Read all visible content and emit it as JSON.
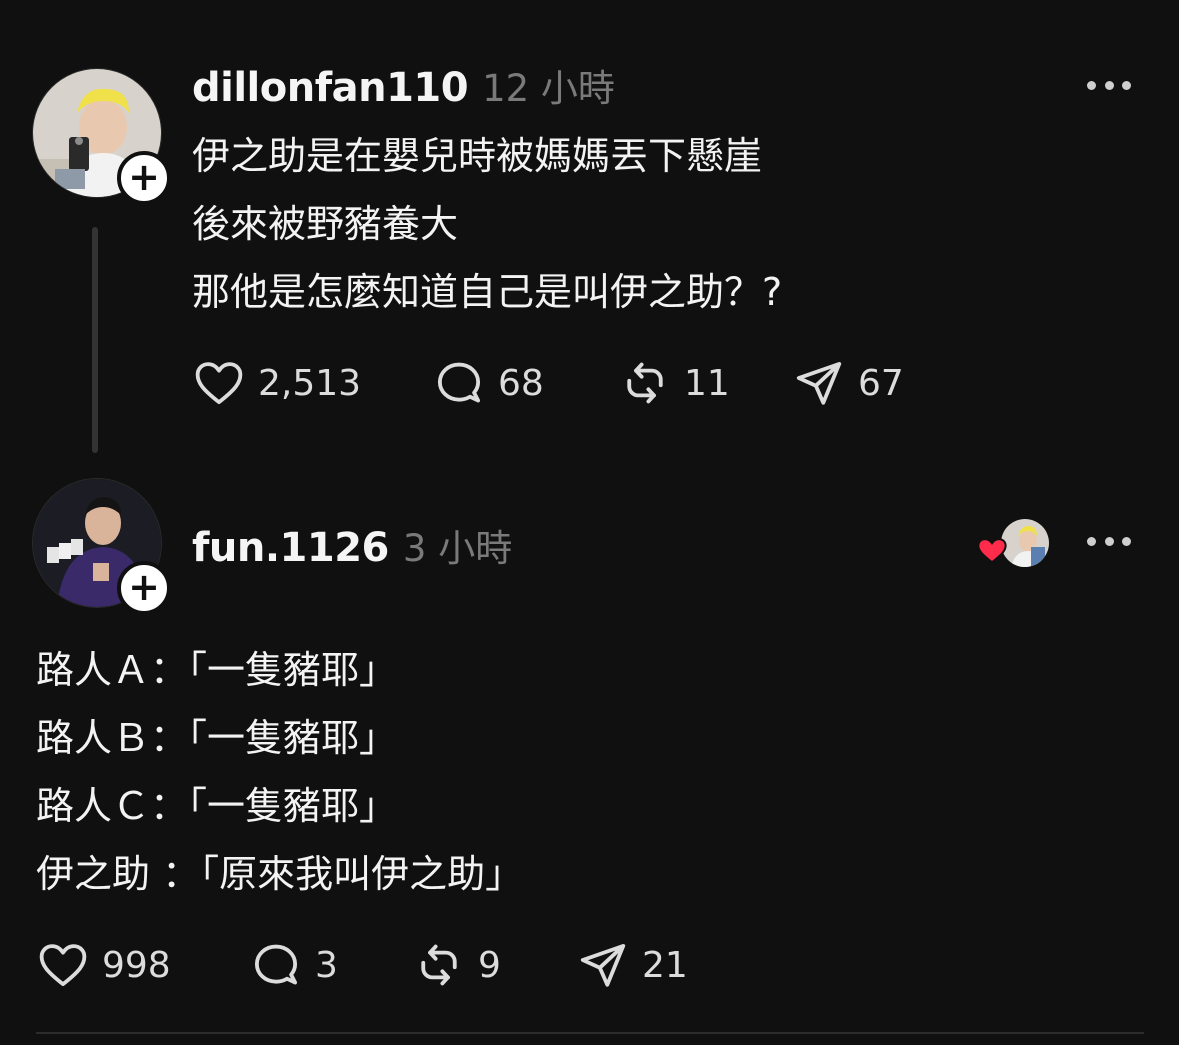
{
  "post": {
    "username": "dillonfan110",
    "time": "12 小時",
    "text": "伊之助是在嬰兒時被媽媽丟下懸崖\n後來被野豬養大\n那他是怎麼知道自己是叫伊之助？?",
    "stats": {
      "likes": "2,513",
      "replies": "68",
      "reposts": "11",
      "shares": "67"
    }
  },
  "reply": {
    "username": "fun.1126",
    "time": "3 小時",
    "text": "路人Ａ：「一隻豬耶」\n路人Ｂ：「一隻豬耶」\n路人Ｃ：「一隻豬耶」\n伊之助 ：「原來我叫伊之助」",
    "stats": {
      "likes": "998",
      "replies": "3",
      "reposts": "9",
      "shares": "21"
    }
  },
  "icons": {
    "like": "heart-icon",
    "reply": "comment-icon",
    "repost": "repost-icon",
    "share": "send-icon",
    "more": "more-icon",
    "follow": "plus-icon"
  },
  "colors": {
    "background": "#101010",
    "text": "#f3f3f3",
    "secondary_text": "#7a7a7a",
    "heart_badge": "#ff2b4a"
  }
}
